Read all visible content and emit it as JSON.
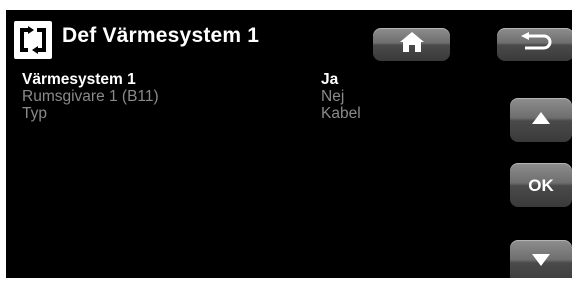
{
  "header": {
    "title": "Def Värmesystem 1",
    "icon": "cycle-arrows-icon"
  },
  "nav": {
    "home_icon": "home-icon",
    "back_icon": "back-arrow-icon",
    "up_icon": "arrow-up-icon",
    "ok_label": "OK",
    "down_icon": "arrow-down-icon"
  },
  "settings": [
    {
      "label": "Värmesystem 1",
      "value": "Ja",
      "selected": true
    },
    {
      "label": "Rumsgivare 1 (B11)",
      "value": "Nej",
      "selected": false
    },
    {
      "label": "Typ",
      "value": "Kabel",
      "selected": false
    }
  ],
  "colors": {
    "background": "#000000",
    "text_active": "#ffffff",
    "text_dim": "#8a8a8a"
  }
}
